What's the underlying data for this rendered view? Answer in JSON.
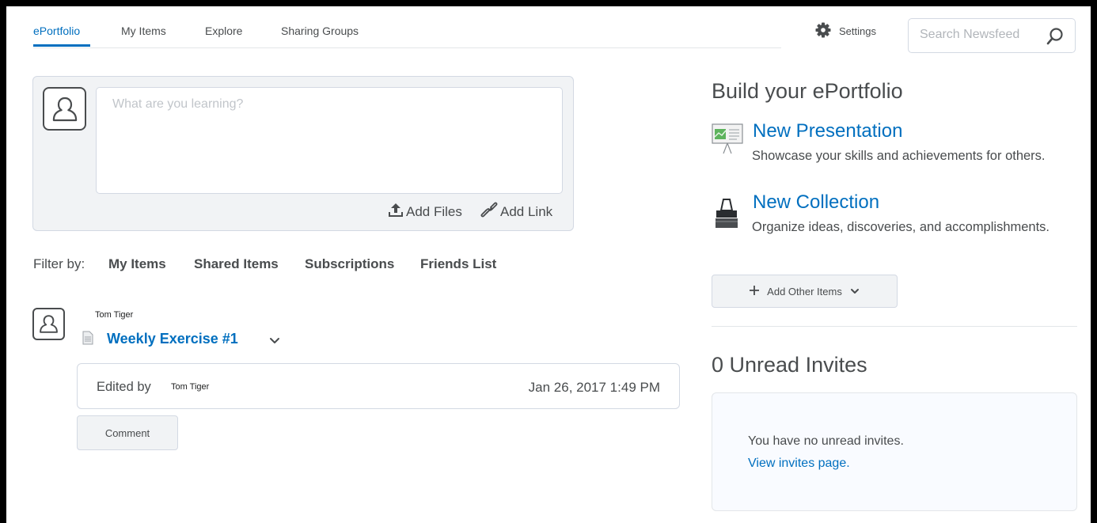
{
  "nav": {
    "tabs": [
      {
        "label": "ePortfolio",
        "active": true
      },
      {
        "label": "My Items",
        "active": false
      },
      {
        "label": "Explore",
        "active": false
      },
      {
        "label": "Sharing Groups",
        "active": false
      }
    ],
    "settings_label": "Settings",
    "search_placeholder": "Search Newsfeed"
  },
  "composer": {
    "placeholder": "What are you learning?",
    "add_files_label": "Add Files",
    "add_link_label": "Add Link"
  },
  "filter": {
    "label": "Filter by:",
    "items": [
      "My Items",
      "Shared Items",
      "Subscriptions",
      "Friends List"
    ]
  },
  "feed": {
    "author": "Tom Tiger",
    "item_title": "Weekly Exercise #1",
    "edited_by_label": "Edited by",
    "edited_by_name": "Tom Tiger",
    "timestamp": "Jan 26, 2017 1:49 PM",
    "comment_label": "Comment"
  },
  "build": {
    "heading": "Build your ePortfolio",
    "presentation_title": "New Presentation",
    "presentation_desc": "Showcase your skills and achievements for others.",
    "collection_title": "New Collection",
    "collection_desc": "Organize ideas, discoveries, and accomplishments.",
    "add_other_label": "Add Other Items"
  },
  "invites": {
    "heading": "0 Unread Invites",
    "message": "You have no unread invites.",
    "link": "View invites page."
  },
  "colors": {
    "accent": "#006fbf",
    "text": "#494c4e",
    "panel_bg": "#f1f3f5",
    "border": "#d3d9e3"
  },
  "icons": [
    "gear-icon",
    "search-icon",
    "avatar-icon",
    "upload-icon",
    "link-icon",
    "document-icon",
    "chevron-down-icon",
    "presentation-icon",
    "binder-clip-icon",
    "plus-icon"
  ]
}
